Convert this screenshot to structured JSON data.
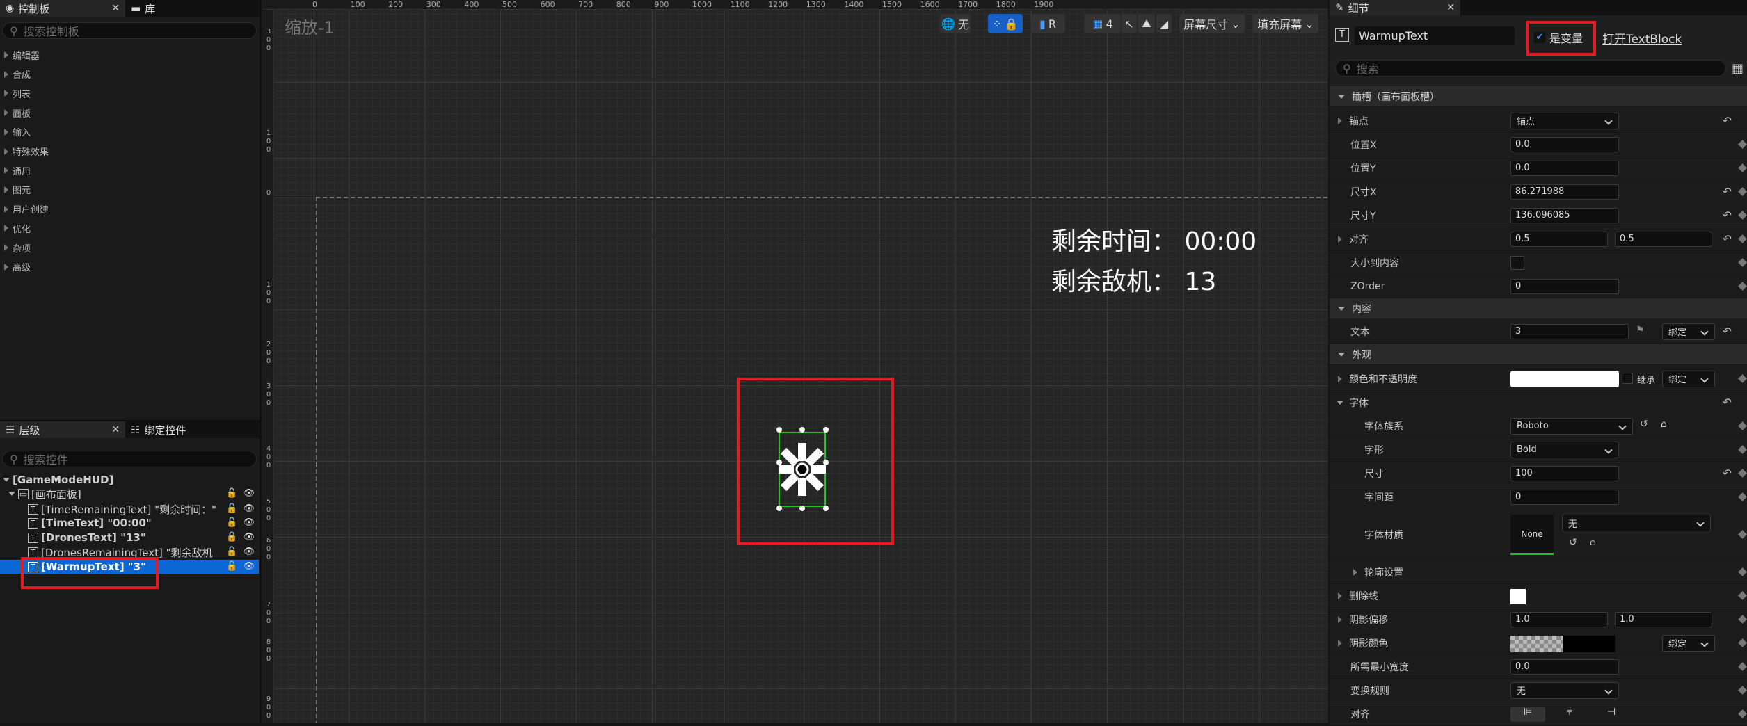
{
  "palette": {
    "tab1": "控制板",
    "tab2": "库",
    "search_placeholder": "搜索控制板",
    "categories": [
      "编辑器",
      "合成",
      "列表",
      "面板",
      "输入",
      "特殊效果",
      "通用",
      "图元",
      "用户创建",
      "优化",
      "杂项",
      "高级"
    ]
  },
  "hierarchy": {
    "tab1": "层级",
    "tab2": "绑定控件",
    "search_placeholder": "搜索控件",
    "items": [
      "[GameModeHUD]",
      "[画布面板]",
      "[TimeRemainingText] \"剩余时间：\"",
      "[TimeText] \"00:00\"",
      "[DronesText] \"13\"",
      "[DronesRemainingText] \"剩余敌机",
      "[WarmupText] \"3\""
    ]
  },
  "viewport": {
    "zoom_label": "缩放-1",
    "toolbar": {
      "none": "无",
      "r": "R",
      "grid": "4",
      "screen_size": "屏幕尺寸",
      "fill_screen": "填充屏幕"
    },
    "ruler_top": [
      "0",
      "100",
      "200",
      "300",
      "400",
      "500",
      "600",
      "700",
      "800",
      "900",
      "1000",
      "1100",
      "1200",
      "1300",
      "1400",
      "1500",
      "1600",
      "1700",
      "1800",
      "1900"
    ],
    "ruler_left": [
      "3 0 0",
      "1 0 0",
      "0",
      "1 0 0",
      "2 0 0",
      "3 0 0",
      "4 0 0",
      "5 0 0",
      "6 0 0",
      "7 0 0",
      "8 0 0",
      "9 0 0",
      "1 0"
    ],
    "hud_time": "剩余时间： 00:00",
    "hud_drones": "剩余敌机： 13"
  },
  "details": {
    "tab": "细节",
    "widget_name": "WarmupText",
    "is_variable_label": "是变量",
    "open_link": "打开TextBlock",
    "search_placeholder": "搜索",
    "slot_section": "插槽（画布面板槽）",
    "anchor_label": "锚点",
    "anchor_value": "锚点",
    "posx_label": "位置X",
    "posx": "0.0",
    "posy_label": "位置Y",
    "posy": "0.0",
    "sizex_label": "尺寸X",
    "sizex": "86.271988",
    "sizey_label": "尺寸Y",
    "sizey": "136.096085",
    "align_label": "对齐",
    "align_x": "0.5",
    "align_y": "0.5",
    "size_to_content_label": "大小到内容",
    "zorder_label": "ZOrder",
    "zorder": "0",
    "content_section": "内容",
    "text_label": "文本",
    "text_value": "3",
    "bind": "绑定",
    "appearance_section": "外观",
    "color_label": "颜色和不透明度",
    "inherit": "继承",
    "font_label": "字体",
    "font_family_label": "字体族系",
    "font_family": "Roboto",
    "typeface_label": "字形",
    "typeface": "Bold",
    "fsize_label": "尺寸",
    "fsize": "100",
    "spacing_label": "字间距",
    "spacing": "0",
    "material_label": "字体材质",
    "material_none": "None",
    "material_value": "无",
    "outline_label": "轮廓设置",
    "strike_label": "删除线",
    "shadow_offset_label": "阴影偏移",
    "shadow_x": "1.0",
    "shadow_y": "1.0",
    "shadow_color_label": "阴影颜色",
    "min_width_label": "所需最小宽度",
    "min_width": "0.0",
    "transform_label": "变换规则",
    "transform": "无",
    "justify_label": "对齐"
  },
  "colors": {
    "accent": "#0b67d4",
    "highlight": "#e31b23",
    "selection_green": "#22c522"
  }
}
